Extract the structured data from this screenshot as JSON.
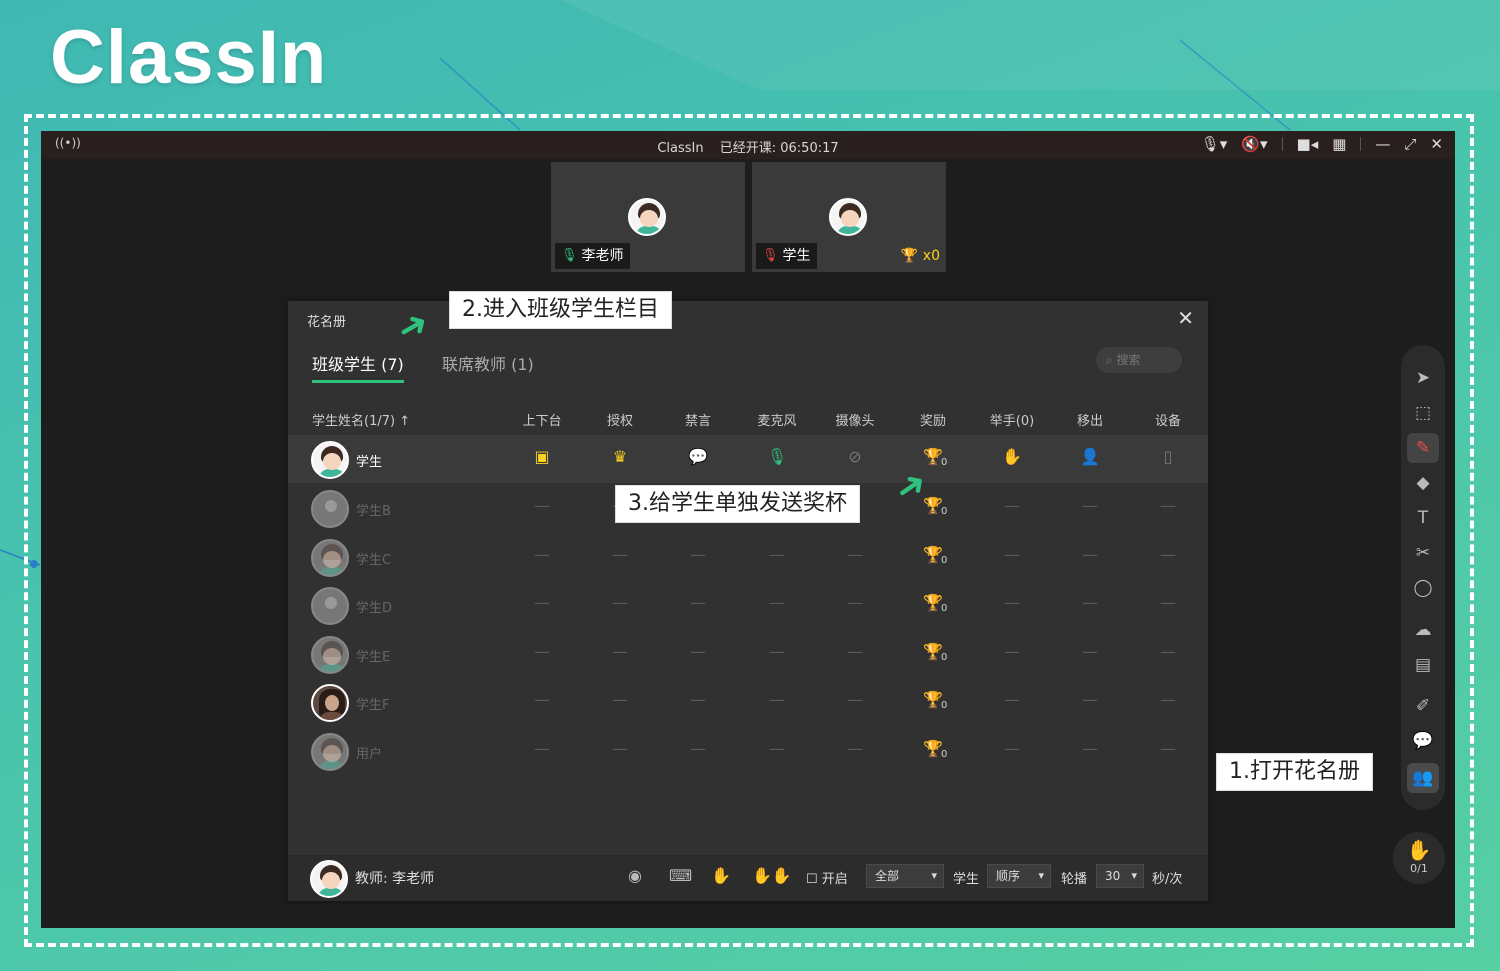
{
  "brand": {
    "logo_text": "ClassIn"
  },
  "window": {
    "title": "ClassIn",
    "class_status": "已经开课: 06:50:17"
  },
  "video_tiles": [
    {
      "name": "李老师",
      "mic": "on"
    },
    {
      "name": "学生",
      "mic": "muted",
      "trophy_count": "x0"
    }
  ],
  "roster": {
    "title": "花名册",
    "tabs": [
      {
        "label": "班级学生 (7)",
        "active": true
      },
      {
        "label": "联席教师 (1)",
        "active": false
      }
    ],
    "search_placeholder": "搜索",
    "columns": [
      "学生姓名(1/7) ↑",
      "上下台",
      "授权",
      "禁言",
      "麦克风",
      "摄像头",
      "奖励",
      "举手(0)",
      "移出",
      "设备"
    ],
    "students": [
      {
        "name": "学生",
        "online": true,
        "trophy": "0"
      },
      {
        "name": "学生B",
        "online": false,
        "trophy": "0"
      },
      {
        "name": "学生C",
        "online": false,
        "trophy": "0"
      },
      {
        "name": "学生D",
        "online": false,
        "trophy": "0"
      },
      {
        "name": "学生E",
        "online": false,
        "trophy": "0"
      },
      {
        "name": "学生F",
        "online": false,
        "trophy": "0"
      },
      {
        "name": "用户",
        "online": false,
        "trophy": "0"
      }
    ],
    "placeholder_dash": "—",
    "footer": {
      "teacher_label": "教师: 李老师",
      "enable_label": "开启",
      "scope_value": "全部",
      "target_label": "学生",
      "order_value": "顺序",
      "rotate_label": "轮播",
      "interval_value": "30",
      "interval_unit": "秒/次"
    }
  },
  "callouts": {
    "step1": "1.打开花名册",
    "step2": "2.进入班级学生栏目",
    "step3": "3.给学生单独发送奖杯"
  },
  "hand_raise": {
    "count": "0/1"
  },
  "colors": {
    "accent": "#2ec27e",
    "trophy": "#f7d21e",
    "danger": "#e0444a"
  }
}
